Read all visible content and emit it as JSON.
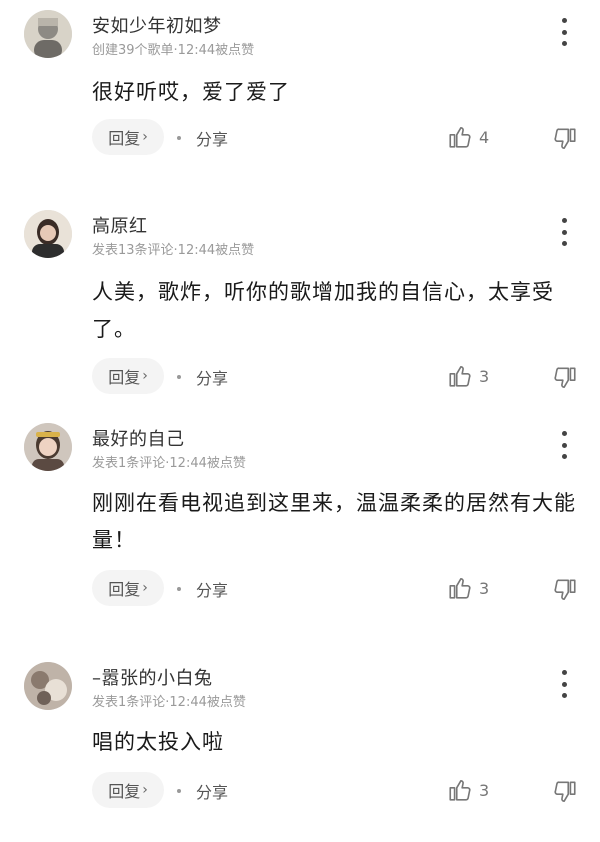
{
  "colors": {
    "background": "#ffffff",
    "meta_text": "#9a9a9a",
    "reply_bg": "#f4f4f4"
  },
  "comments": [
    {
      "username": "安如少年初如梦",
      "meta": "创建39个歌单·12:44被点赞",
      "text": "很好听哎，爱了爱了",
      "reply_label": "回复",
      "share_label": "分享",
      "like_count": "4",
      "avatar_icon": "avatar-icon"
    },
    {
      "username": "高原红",
      "meta": "发表13条评论·12:44被点赞",
      "text": "人美，歌炸，听你的歌增加我的自信心，太享受了。",
      "reply_label": "回复",
      "share_label": "分享",
      "like_count": "3",
      "avatar_icon": "avatar-icon"
    },
    {
      "username": "最好的自己",
      "meta": "发表1条评论·12:44被点赞",
      "text": "刚刚在看电视追到这里来，温温柔柔的居然有大能量！",
      "reply_label": "回复",
      "share_label": "分享",
      "like_count": "3",
      "avatar_icon": "avatar-icon"
    },
    {
      "username": "–嚣张的小白兔",
      "meta": "发表1条评论·12:44被点赞",
      "text": "唱的太投入啦",
      "reply_label": "回复",
      "share_label": "分享",
      "like_count": "3",
      "avatar_icon": "avatar-icon"
    }
  ]
}
